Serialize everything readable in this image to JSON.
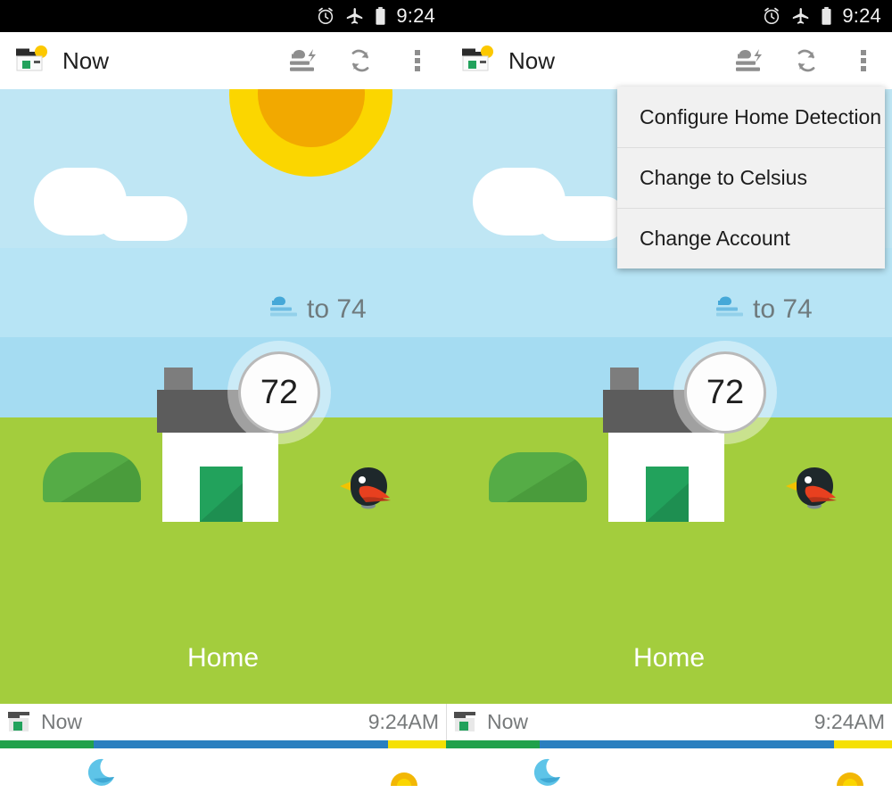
{
  "status_bar": {
    "alarm_icon": "alarm-clock-icon",
    "airplane_icon": "airplane-mode-icon",
    "battery_icon": "battery-icon",
    "time": "9:24"
  },
  "app_bar": {
    "logo_icon": "home-thermostat-logo-icon",
    "title": "Now",
    "actions": [
      {
        "icon": "fan-boost-icon",
        "name": "fan-icon"
      },
      {
        "icon": "refresh-icon",
        "name": "refresh-icon"
      },
      {
        "icon": "overflow-menu-icon",
        "name": "overflow-icon"
      }
    ]
  },
  "overflow_menu": {
    "items": [
      {
        "label": "Configure Home Detection"
      },
      {
        "label": "Change to Celsius"
      },
      {
        "label": "Change Account"
      }
    ]
  },
  "scene": {
    "setpoint_icon": "cooling-fan-icon",
    "setpoint_text": "to 74",
    "current_temp": "72",
    "location_label": "Home",
    "colors": {
      "sky_top": "#bfe6f4",
      "sky_mid": "#b7e4f5",
      "sky_low": "#a5dcf2",
      "grass": "#a3cd3d",
      "sun_outer": "#fbd600",
      "sun_inner": "#f2a900",
      "roof": "#5c5c5c",
      "chimney": "#7d7d7d",
      "door": "#22a25c",
      "bush": "#55ac46",
      "setpoint_text": "#6f7a7d"
    }
  },
  "timeline": {
    "icon": "home-icon",
    "now_label": "Now",
    "end_time": "9:24AM",
    "segments": [
      {
        "name": "green-segment",
        "color": "#21a14b",
        "width_pct": 21
      },
      {
        "name": "blue-segment",
        "color": "#2a7fbf",
        "width_pct": 66
      },
      {
        "name": "yellow-segment",
        "color": "#f5e003",
        "width_pct": 13
      }
    ],
    "markers": [
      {
        "name": "moon-icon",
        "left_pct": 21
      },
      {
        "name": "sun-icon",
        "left_pct": 87
      }
    ]
  }
}
